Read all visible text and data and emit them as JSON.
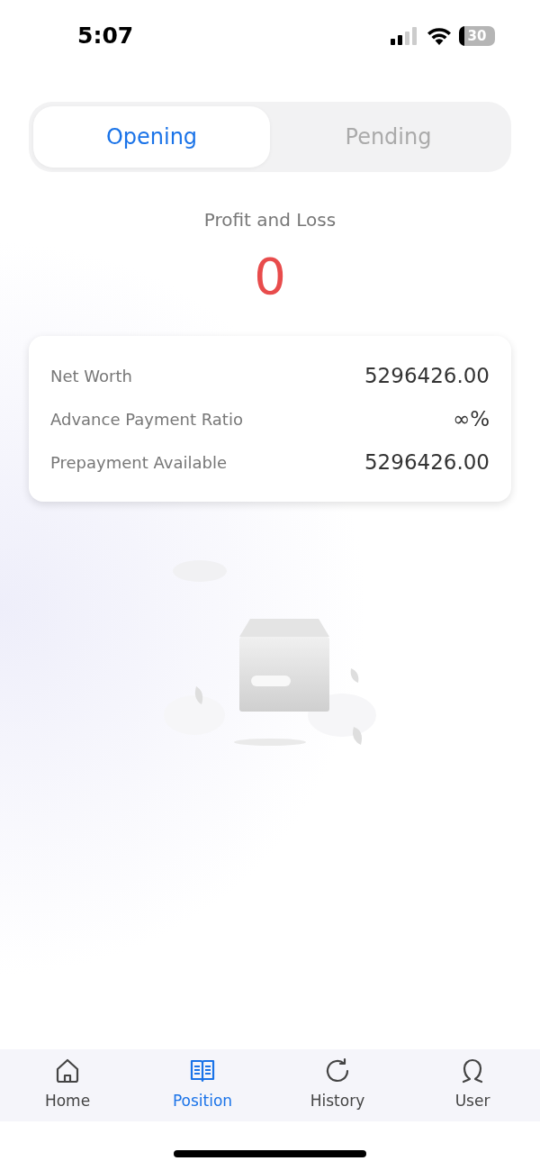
{
  "status_bar": {
    "time": "5:07",
    "battery": "30"
  },
  "tabs": [
    {
      "label": "Opening",
      "selected": true
    },
    {
      "label": "Pending",
      "selected": false
    }
  ],
  "summary": {
    "label": "Profit and Loss",
    "value": "0"
  },
  "stats": [
    {
      "label": "Net Worth",
      "value": "5296426.00"
    },
    {
      "label": "Advance Payment Ratio",
      "value": "∞%"
    },
    {
      "label": "Prepayment Available",
      "value": "5296426.00"
    }
  ],
  "bottom_nav": [
    {
      "label": "Home",
      "selected": false
    },
    {
      "label": "Position",
      "selected": true
    },
    {
      "label": "History",
      "selected": false
    },
    {
      "label": "User",
      "selected": false
    }
  ]
}
